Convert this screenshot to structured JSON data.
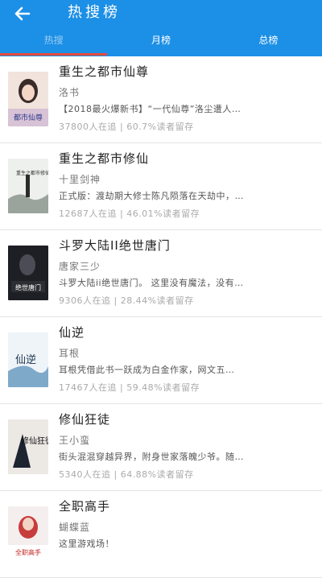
{
  "header": {
    "title": "热搜榜",
    "back_icon": "arrow-left-icon",
    "background": "#1c8fe6"
  },
  "tabs": [
    {
      "label": "热搜"
    },
    {
      "label": "月榜"
    },
    {
      "label": "总榜"
    }
  ],
  "active_tab": 0,
  "accent_color": "#e44b3a",
  "books": [
    {
      "title": "重生之都市仙尊",
      "author": "洛书",
      "desc": "【2018最火爆新书】“一代仙尊”洛尘遭人…",
      "stats": "37800人在追 | 60.7%读者留存",
      "cover_text": "都市仙尊"
    },
    {
      "title": "重生之都市修仙",
      "author": "十里剑神",
      "desc": "正式版：渡劫期大修士陈凡陨落在天劫中，…",
      "stats": "12687人在追 | 46.01%读者留存",
      "cover_text": "重生之都市修仙"
    },
    {
      "title": "斗罗大陆II绝世唐门",
      "author": "唐家三少",
      "desc": "斗罗大陆ii绝世唐门。 这里没有魔法，没有…",
      "stats": "9306人在追 | 28.44%读者留存",
      "cover_text": "绝世唐门"
    },
    {
      "title": "仙逆",
      "author": "耳根",
      "desc": "耳根凭借此书一跃成为白金作家，网文五…",
      "stats": "17467人在追 | 59.48%读者留存",
      "cover_text": "仙逆"
    },
    {
      "title": "修仙狂徒",
      "author": "王小蛮",
      "desc": "街头混混穿越异界，附身世家落魄少爷。随…",
      "stats": "5340人在追 | 64.88%读者留存",
      "cover_text": "修仙狂徒"
    },
    {
      "title": "全职高手",
      "author": "蝴蝶蓝",
      "desc": "这里游戏场！",
      "stats": "",
      "cover_text": "全职高手"
    }
  ]
}
